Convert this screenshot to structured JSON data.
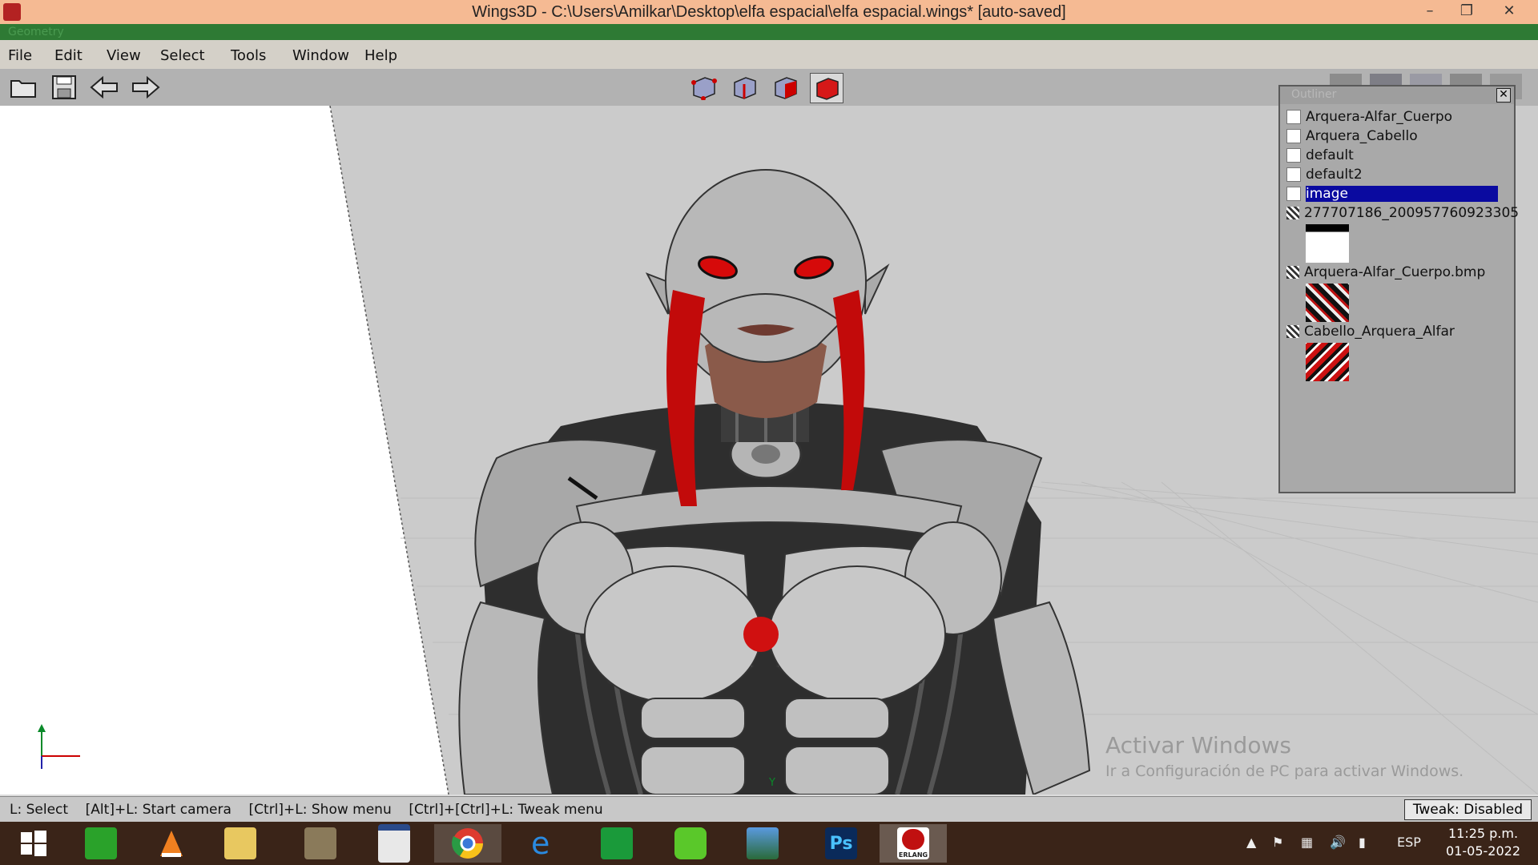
{
  "window": {
    "title": "Wings3D - C:\\Users\\Amilkar\\Desktop\\elfa espacial\\elfa espacial.wings* [auto-saved]",
    "minimize_glyph": "–",
    "restore_glyph": "❐",
    "close_glyph": "✕",
    "titlebar_color": "#f5ba93"
  },
  "geometry_strip": {
    "label": "Geometry"
  },
  "menubar": {
    "items": [
      "File",
      "Edit",
      "View",
      "Select",
      "Tools",
      "Window",
      "Help"
    ]
  },
  "toolbar": {
    "left_icons": [
      "open-folder-icon",
      "save-icon",
      "undo-arrow-icon",
      "redo-arrow-icon"
    ],
    "selection_modes": [
      "vertex-mode-icon",
      "edge-mode-icon",
      "face-mode-icon",
      "body-mode-icon"
    ],
    "active_mode": "body-mode-icon"
  },
  "outliner": {
    "title": "Outliner",
    "close_glyph": "✕",
    "materials": [
      {
        "label": "Arquera-Alfar_Cuerpo"
      },
      {
        "label": "Arquera_Cabello"
      },
      {
        "label": "default"
      },
      {
        "label": "default2"
      },
      {
        "label": "image",
        "selected": true
      }
    ],
    "images": [
      {
        "label": "277707186_200957760923305"
      },
      {
        "label": "Arquera-Alfar_Cuerpo.bmp"
      },
      {
        "label": "Cabello_Arquera_Alfar"
      }
    ],
    "selected_color": "#0a0aa0"
  },
  "viewport": {
    "axis_y_label": "Y"
  },
  "watermark": {
    "line1": "Activar Windows",
    "line2": "Ir a Configuración de PC para activar Windows."
  },
  "statusbar": {
    "hints": "L: Select    [Alt]+L: Start camera    [Ctrl]+L: Show menu    [Ctrl]+[Ctrl]+L: Tweak menu",
    "tweak": "Tweak: Disabled"
  },
  "taskbar": {
    "apps": [
      "windows-start-icon",
      "store-icon",
      "vlc-icon",
      "file-explorer-icon",
      "scroll-app-icon",
      "window-app-icon",
      "chrome-icon",
      "internet-explorer-icon",
      "calculator-icon",
      "wifi-app-icon",
      "photo-viewer-icon",
      "photoshop-icon",
      "erlang-icon"
    ],
    "ps_label": "Ps",
    "erlang_label": "ERLANG",
    "language": "ESP",
    "time": "11:25 p.m.",
    "date": "01-05-2022"
  }
}
